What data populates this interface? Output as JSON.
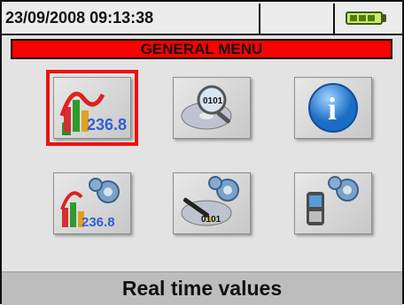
{
  "status": {
    "datetime": "23/09/2008 09:13:38",
    "battery_icon": "battery-full-icon",
    "battery_color": "#4f7c10"
  },
  "menu": {
    "title": "GENERAL MENU",
    "title_bg": "#ff0000",
    "items": [
      {
        "icon": "real-time-chart-icon",
        "value_text": "236.8",
        "selected": true
      },
      {
        "icon": "data-search-icon",
        "value_text": "0101"
      },
      {
        "icon": "info-icon",
        "value_text": "i"
      },
      {
        "icon": "analyzer-settings-icon",
        "value_text": "236.8"
      },
      {
        "icon": "recording-settings-icon",
        "value_text": "0101"
      },
      {
        "icon": "instrument-settings-icon"
      }
    ]
  },
  "footer": {
    "selected_label": "Real time values"
  }
}
